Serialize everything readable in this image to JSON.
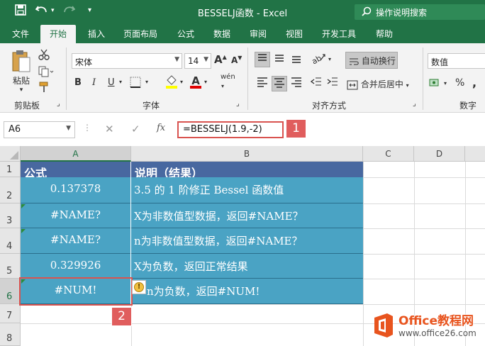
{
  "titlebar": {
    "title": "BESSELJ函数  -  Excel",
    "search_placeholder": "操作说明搜索"
  },
  "tabs": [
    "文件",
    "开始",
    "插入",
    "页面布局",
    "公式",
    "数据",
    "审阅",
    "视图",
    "开发工具",
    "帮助"
  ],
  "ribbon": {
    "clipboard": {
      "paste_label": "粘贴",
      "group_label": "剪贴板"
    },
    "font": {
      "font_name": "宋体",
      "font_size": "14",
      "bold": "B",
      "italic": "I",
      "underline": "U",
      "font_color_letter": "A",
      "phonetic": "wén",
      "group_label": "字体"
    },
    "alignment": {
      "wrap_text": "自动换行",
      "merge_center": "合并后居中",
      "group_label": "对齐方式"
    },
    "number": {
      "format": "数值",
      "percent": "%",
      "comma": ",",
      "group_label": "数字"
    }
  },
  "formula_bar": {
    "name_box": "A6",
    "fx": "fx",
    "formula": "=BESSELJ(1.9,-2)",
    "badge": "1"
  },
  "sheet": {
    "columns": [
      "A",
      "B",
      "C",
      "D"
    ],
    "rows": [
      "1",
      "2",
      "3",
      "4",
      "5",
      "6",
      "7",
      "8"
    ],
    "header": {
      "a": "公式",
      "b": "说明（结果）"
    },
    "data": [
      {
        "a": "0.137378",
        "b": "3.5 的 1 阶修正 Bessel 函数值"
      },
      {
        "a": "#NAME?",
        "b": "X为非数值型数据，返回#NAME？"
      },
      {
        "a": "#NAME?",
        "b": "n为非数值型数据，返回#NAME？"
      },
      {
        "a": "0.329926",
        "b": "X为负数，返回正常结果"
      },
      {
        "a": "#NUM!",
        "b": "n为负数，返回#NUM!"
      }
    ],
    "badge": "2"
  },
  "watermark": {
    "brand": "Office教程网",
    "url": "www.office26.com"
  },
  "colors": {
    "excel_green": "#217346",
    "header_fill": "#4868a0",
    "data_fill": "#4aa3c4",
    "highlight_red": "#d9534f"
  }
}
